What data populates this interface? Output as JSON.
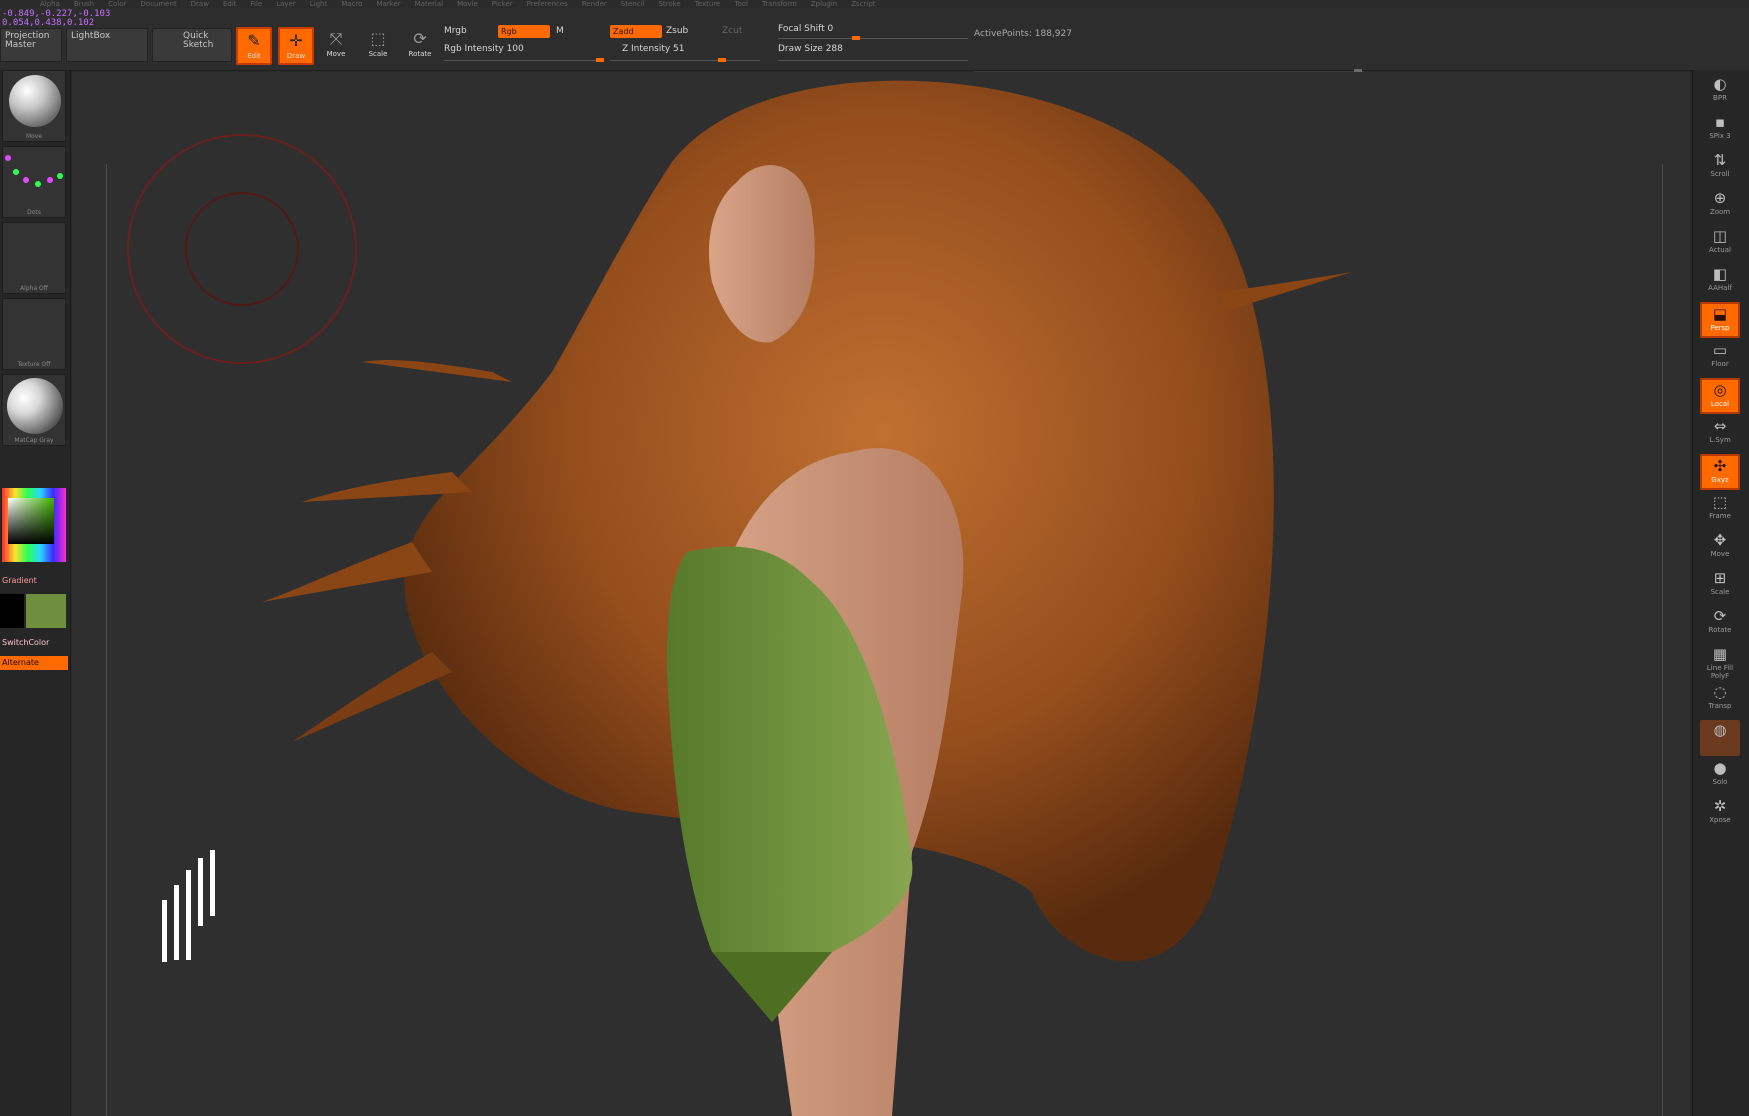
{
  "menu": [
    "Alpha",
    "Brush",
    "Color",
    "Document",
    "Draw",
    "Edit",
    "File",
    "Layer",
    "Light",
    "Macro",
    "Marker",
    "Material",
    "Movie",
    "Picker",
    "Preferences",
    "Render",
    "Stencil",
    "Stroke",
    "Texture",
    "Tool",
    "Transform",
    "Zplugin",
    "Zscript"
  ],
  "coords": {
    "line1": "-0.849,-0.227,-0.103",
    "line2": "0.054,0.438,0.102"
  },
  "toolbar": {
    "projection": "Projection\nMaster",
    "lightbox": "LightBox",
    "quick_sketch": "Quick\nSketch",
    "edit": "Edit",
    "draw": "Draw",
    "move": "Move",
    "scale": "Scale",
    "rotate": "Rotate",
    "mrgb": "Mrgb",
    "rgb": "Rgb",
    "m": "M",
    "rgb_intensity": "Rgb Intensity 100",
    "zadd": "Zadd",
    "zsub": "Zsub",
    "zcut": "Zcut",
    "z_intensity": "Z Intensity 51",
    "focal_shift": "Focal Shift 0",
    "draw_size": "Draw Size 288",
    "active_points": "ActivePoints: 188,927"
  },
  "left": {
    "brush_cap": "Move",
    "stroke_cap": "Dots",
    "alpha_cap": "Alpha Off",
    "texture_cap": "Texture Off",
    "material_cap": "MatCap Gray",
    "gradient": "Gradient",
    "switch_color": "SwitchColor",
    "alternate": "Alternate",
    "accent": "#ff6a00",
    "main_color": "#6f8f3e",
    "secondary_color": "#000000"
  },
  "right": [
    {
      "icon": "bpr-icon",
      "label": "BPR"
    },
    {
      "icon": "spix-icon",
      "label": "SPix 3"
    },
    {
      "icon": "scroll-icon",
      "label": "Scroll"
    },
    {
      "icon": "zoom-icon",
      "label": "Zoom"
    },
    {
      "icon": "actual-icon",
      "label": "Actual"
    },
    {
      "icon": "aahalf-icon",
      "label": "AAHalf"
    },
    {
      "icon": "persp-icon",
      "label": "Persp"
    },
    {
      "icon": "floor-icon",
      "label": "Floor"
    },
    {
      "icon": "local-icon",
      "label": "Local"
    },
    {
      "icon": "lsym-icon",
      "label": "L.Sym"
    },
    {
      "icon": "xyz-icon",
      "label": "Gxyz"
    },
    {
      "icon": "frame-icon",
      "label": "Frame"
    },
    {
      "icon": "move-icon",
      "label": "Move"
    },
    {
      "icon": "zoom3d-icon",
      "label": "Scale"
    },
    {
      "icon": "rotate-icon",
      "label": "Rotate"
    },
    {
      "icon": "polyf-icon",
      "label": "Line Fill PolyF"
    },
    {
      "icon": "transp-icon",
      "label": "Transp"
    },
    {
      "icon": "ghost-icon",
      "label": ""
    },
    {
      "icon": "solo-icon",
      "label": "Solo"
    },
    {
      "icon": "xpose-icon",
      "label": "Xpose"
    }
  ]
}
